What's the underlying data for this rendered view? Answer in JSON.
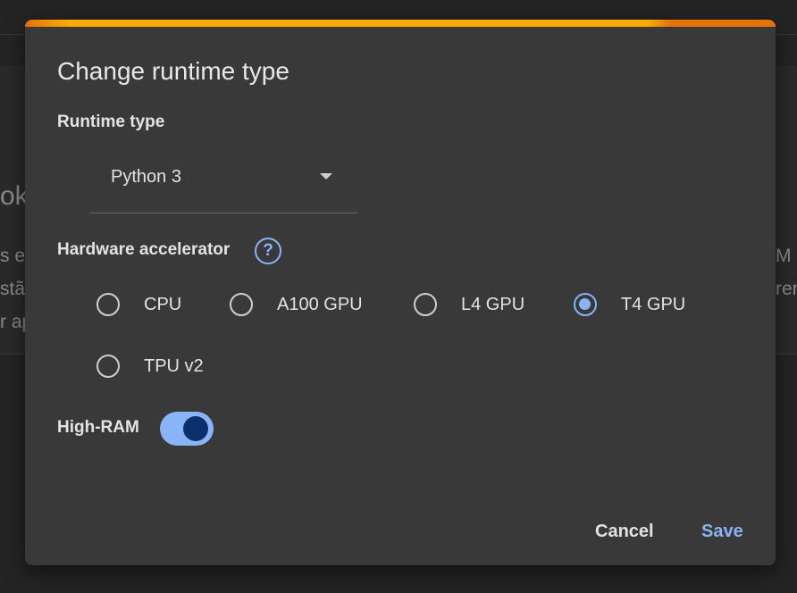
{
  "background": {
    "title_fragment": "ok",
    "line1_left": "s e",
    "line2_left": "stão",
    "line3_left": "r ap",
    "line1_right": "M c",
    "line2_right": "ren"
  },
  "dialog": {
    "title": "Change runtime type",
    "accent_colors": [
      "#e8710a",
      "#f9ab00"
    ],
    "runtime_type": {
      "label": "Runtime type",
      "selected_value": "Python 3",
      "icon": "caret-down-icon"
    },
    "hardware_accelerator": {
      "label": "Hardware accelerator",
      "help_icon": "help-icon",
      "help_glyph": "?",
      "selected": "T4 GPU",
      "options": [
        {
          "label": "CPU",
          "checked": false
        },
        {
          "label": "A100 GPU",
          "checked": false
        },
        {
          "label": "L4 GPU",
          "checked": false
        },
        {
          "label": "T4 GPU",
          "checked": true
        },
        {
          "label": "TPU v2",
          "checked": false
        }
      ]
    },
    "high_ram": {
      "label": "High-RAM",
      "enabled": true
    },
    "buttons": {
      "cancel": "Cancel",
      "save": "Save"
    }
  },
  "colors": {
    "accent_blue": "#8ab4f8",
    "dialog_bg": "#393939",
    "page_bg": "#242424"
  }
}
